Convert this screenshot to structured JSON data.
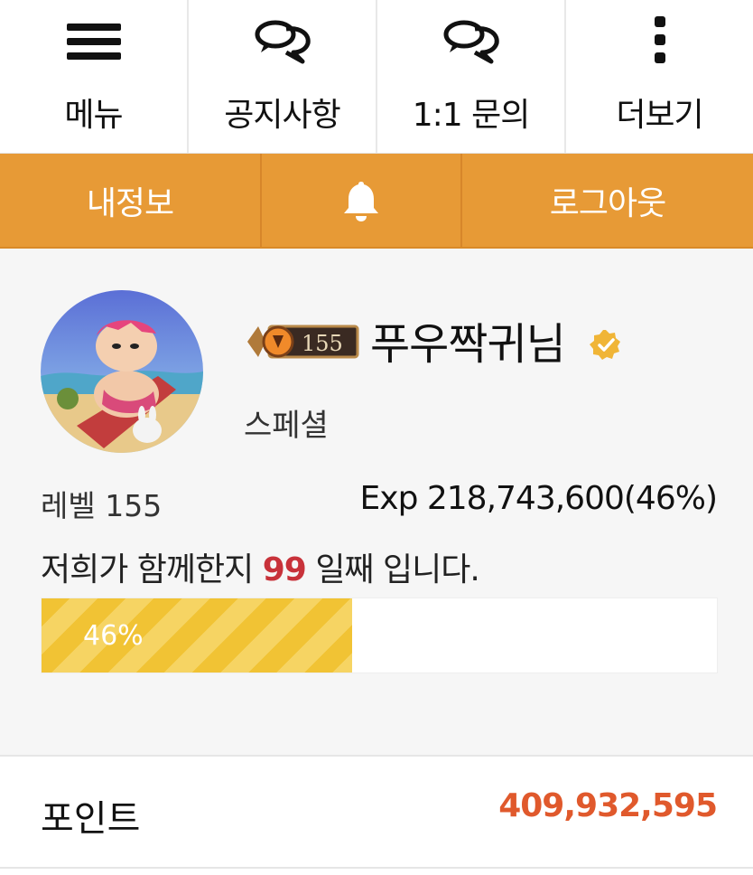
{
  "topnav": {
    "items": [
      {
        "label": "메뉴",
        "icon": "hamburger-menu-icon"
      },
      {
        "label": "공지사항",
        "icon": "chat-bubbles-icon"
      },
      {
        "label": "1:1 문의",
        "icon": "chat-bubbles-icon"
      },
      {
        "label": "더보기",
        "icon": "vertical-dots-icon"
      }
    ]
  },
  "actionbar": {
    "my_info": "내정보",
    "notifications_icon": "bell-icon",
    "logout": "로그아웃"
  },
  "profile": {
    "rank_badge_level": "155",
    "nickname": "푸우짝귀님",
    "role": "스페셜",
    "level_label": "레벨 155",
    "exp_label": "Exp 218,743,600(46%)",
    "together_prefix": "저희가 함께한지",
    "together_days": "99",
    "together_suffix": "일째 입니다.",
    "progress_percent": 46,
    "progress_label": "46%"
  },
  "points": {
    "label": "포인트",
    "value": "409,932,595"
  },
  "colors": {
    "accent_orange": "#e79a36",
    "progress_yellow": "#f1c334",
    "points_value": "#e0592c",
    "days_highlight": "#c8323a"
  }
}
